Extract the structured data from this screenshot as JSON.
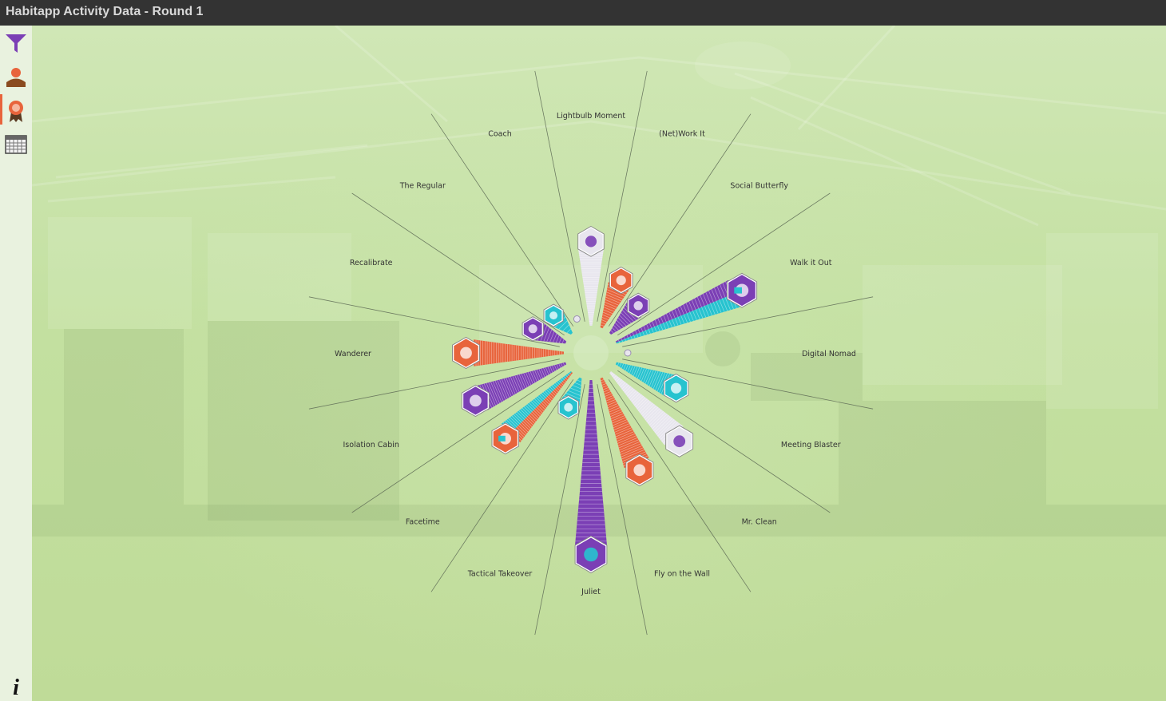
{
  "window": {
    "title": "Habitapp Activity Data - Round 1"
  },
  "sidebar": {
    "items": [
      {
        "name": "filter",
        "icon": "filter-icon",
        "color": "#7b3fb5",
        "active": false
      },
      {
        "name": "people",
        "icon": "person-icon",
        "color": "#e8643c",
        "active": false
      },
      {
        "name": "badges",
        "icon": "award-icon",
        "color": "#e8643c",
        "active": true
      },
      {
        "name": "calendar",
        "icon": "calendar-icon",
        "color": "#555555",
        "active": false
      }
    ],
    "info_label": "i"
  },
  "badges": [
    {
      "label": "Lightbulb Moment",
      "color": "#e8e6ee",
      "icon_color": "#7b3fb5",
      "count": 35,
      "style": "stack"
    },
    {
      "label": "(Net)Work It",
      "color": "#e8643c",
      "count": 18,
      "style": "stack"
    },
    {
      "label": "Social Butterfly",
      "color": "#7b3fb5",
      "count": 12,
      "style": "stack"
    },
    {
      "label": "Walk it Out",
      "color": "#7b3fb5",
      "accent": "#27c3cf",
      "count": 62,
      "style": "double"
    },
    {
      "label": "Digital Nomad",
      "color": "#e8e6ee",
      "count": 2,
      "style": "dot"
    },
    {
      "label": "Meeting Blaster",
      "color": "#27c3cf",
      "count": 25,
      "style": "stack"
    },
    {
      "label": "Mr. Clean",
      "color": "#e8e6ee",
      "icon_color": "#7b3fb5",
      "count": 42,
      "style": "stack"
    },
    {
      "label": "Fly on the Wall",
      "color": "#e8643c",
      "count": 43,
      "style": "stack"
    },
    {
      "label": "Juliet",
      "color": "#7b3fb5",
      "icon_color": "#27c3cf",
      "count": 82,
      "style": "stack"
    },
    {
      "label": "Tactical Takeover",
      "color": "#27c3cf",
      "count": 8,
      "style": "stack"
    },
    {
      "label": "Facetime",
      "color": "#e8643c",
      "accent": "#27c3cf",
      "count": 40,
      "style": "double"
    },
    {
      "label": "Isolation Cabin",
      "color": "#7b3fb5",
      "count": 42,
      "style": "stack"
    },
    {
      "label": "Wanderer",
      "color": "#e8643c",
      "count": 42,
      "style": "stack"
    },
    {
      "label": "Recalibrate",
      "color": "#7b3fb5",
      "count": 10,
      "style": "stack"
    },
    {
      "label": "The Regular",
      "color": "#27c3cf",
      "count": 5,
      "style": "stack"
    },
    {
      "label": "Coach",
      "color": "#e8e6ee",
      "count": 2,
      "style": "dot"
    }
  ]
}
